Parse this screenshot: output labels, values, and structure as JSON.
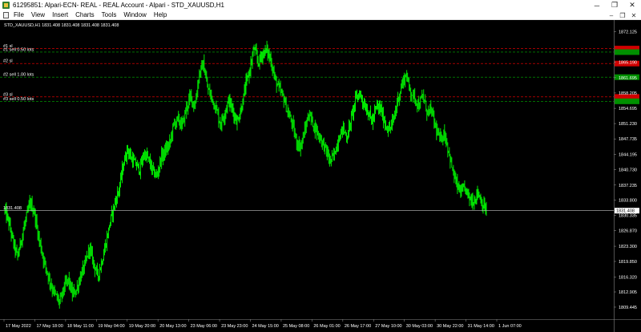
{
  "window": {
    "title": "61295851: Alpari-ECN- REAL -  REAL Account - Alpari -   STD_XAUUSD,H1",
    "minimize": "─",
    "restore": "❐",
    "close": "✕"
  },
  "menu": {
    "items": [
      "File",
      "View",
      "Insert",
      "Charts",
      "Tools",
      "Window",
      "Help"
    ],
    "mdi_minimize": "–",
    "mdi_restore": "❐",
    "mdi_close": "✕"
  },
  "chart": {
    "header": "STD_XAUUSD,H1  1831.408 1831.408 1831.408 1831.408",
    "current_price": "1831.408",
    "colors": {
      "background": "#000000",
      "candle": "#00ff00",
      "text": "#ffffff",
      "sl_line": "#ff0000",
      "order_line": "#00b000",
      "bid_line": "#c0c0c0"
    }
  },
  "chart_data": {
    "type": "candlestick",
    "symbol": "STD_XAUUSD",
    "timeframe": "H1",
    "ylim": [
      1806.7,
      1874.8
    ],
    "y_ticks": [
      1872.125,
      1865.19,
      1861.695,
      1858.205,
      1854.695,
      1851.23,
      1847.735,
      1844.195,
      1840.73,
      1837.235,
      1833.8,
      1830.335,
      1826.87,
      1823.3,
      1819.85,
      1816.32,
      1812.905,
      1809.445
    ],
    "x_tick_labels": [
      "17 May 2022",
      "17 May 18:00",
      "18 May 11:00",
      "19 May 04:00",
      "19 May 20:00",
      "20 May 13:00",
      "23 May 06:00",
      "23 May 23:00",
      "24 May 15:00",
      "25 May 08:00",
      "26 May 01:00",
      "26 May 17:00",
      "27 May 10:00",
      "30 May 03:00",
      "30 May 22:00",
      "31 May 14:00",
      "1 Jun 07:00"
    ],
    "bid": 1831.408,
    "orders": [
      {
        "sl_label": "#1 sl",
        "order_label": "#1 sell 0.50 lots",
        "sl_price": 1868.3,
        "order_price": 1867.5
      },
      {
        "sl_label": "#2 sl",
        "order_label": "#2 sell 1.00 lots",
        "sl_price": 1864.9,
        "order_price": 1861.8
      },
      {
        "sl_label": "#3 sl",
        "order_label": "#3 sell 0.50 lots",
        "sl_price": 1857.3,
        "order_price": 1856.3
      }
    ],
    "price_path": [
      1831.5,
      1828.5,
      1824.2,
      1820.8,
      1825.3,
      1829.5,
      1833.2,
      1831.0,
      1825.4,
      1821.0,
      1817.5,
      1814.3,
      1812.1,
      1810.5,
      1813.9,
      1815.8,
      1812.3,
      1813.5,
      1816.7,
      1819.1,
      1823.0,
      1819.6,
      1816.5,
      1820.0,
      1824.3,
      1829.2,
      1833.0,
      1836.2,
      1841.5,
      1845.5,
      1843.2,
      1842.0,
      1840.8,
      1844.5,
      1843.1,
      1840.5,
      1839.2,
      1843.5,
      1845.0,
      1846.5,
      1851.1,
      1852.2,
      1850.7,
      1854.8,
      1857.5,
      1855.0,
      1862.5,
      1864.8,
      1859.3,
      1857.0,
      1854.8,
      1851.1,
      1853.5,
      1856.6,
      1854.1,
      1851.6,
      1854.7,
      1859.8,
      1863.5,
      1868.4,
      1865.0,
      1867.2,
      1868.0,
      1865.5,
      1861.2,
      1858.9,
      1857.1,
      1853.6,
      1851.4,
      1847.2,
      1845.9,
      1849.5,
      1853.6,
      1851.1,
      1849.2,
      1847.4,
      1845.3,
      1842.5,
      1844.2,
      1847.8,
      1850.3,
      1848.0,
      1852.3,
      1856.7,
      1858.2,
      1855.7,
      1853.9,
      1851.6,
      1855.1,
      1854.5,
      1851.2,
      1849.7,
      1851.9,
      1856.5,
      1860.0,
      1862.5,
      1858.6,
      1857.2,
      1855.3,
      1857.5,
      1853.8,
      1854.2,
      1850.3,
      1847.5,
      1849.2,
      1845.3,
      1840.5,
      1837.2,
      1835.4,
      1836.5,
      1834.2,
      1833.5,
      1835.8,
      1833.0,
      1831.4
    ]
  }
}
